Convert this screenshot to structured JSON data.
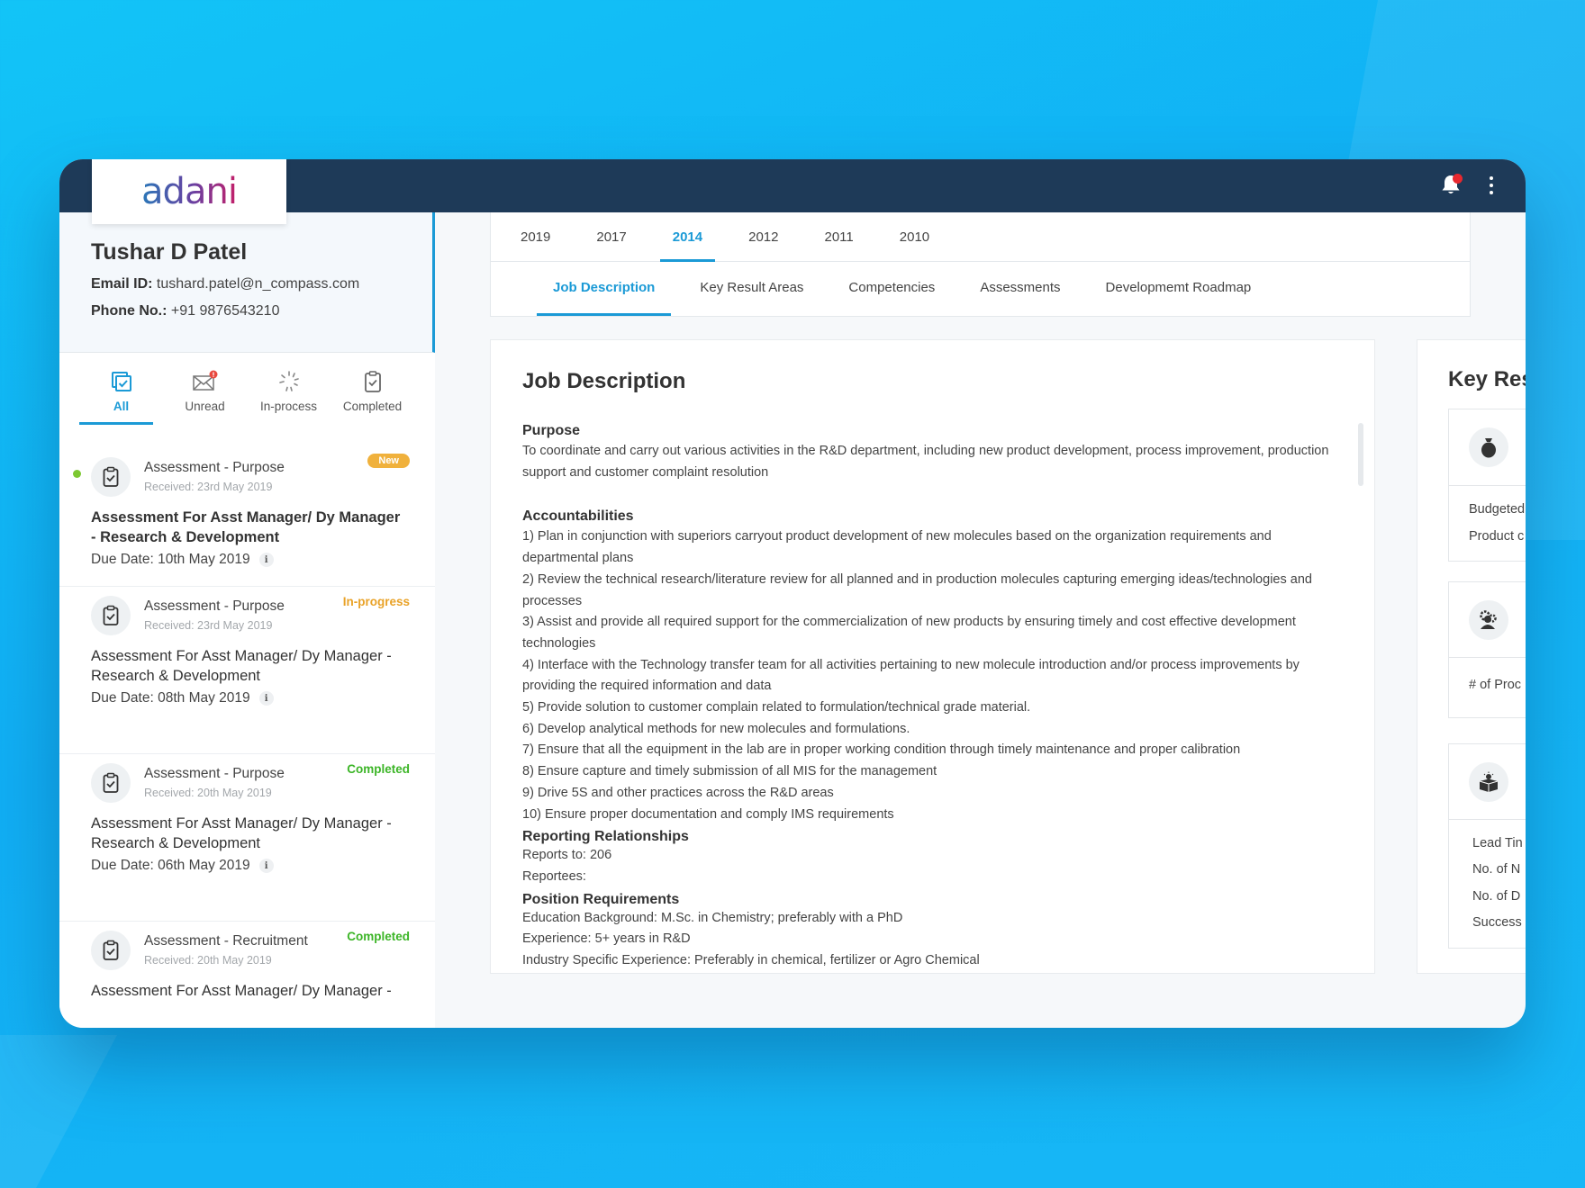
{
  "app": {
    "brand": "adani",
    "colors": {
      "accent": "#1b9ad6",
      "topbar": "#1e3a58",
      "new_badge": "#f0b13c",
      "in_progress": "#e9a227",
      "completed": "#3cb527",
      "unread_dot": "#7dc832",
      "notification": "#e8282f"
    }
  },
  "topbar": {
    "notification_icon": "bell-icon",
    "menu_icon": "more-vertical-icon"
  },
  "profile": {
    "name": "Tushar D Patel",
    "email_label": "Email ID:",
    "email": "tushard.patel@n_compass.com",
    "phone_label": "Phone No.:",
    "phone": "+91 9876543210"
  },
  "filters": [
    {
      "label": "All",
      "icon": "all-check-icon",
      "active": true
    },
    {
      "label": "Unread",
      "icon": "mail-icon",
      "active": false
    },
    {
      "label": "In-process",
      "icon": "spinner-icon",
      "active": false
    },
    {
      "label": "Completed",
      "icon": "clipboard-check-icon",
      "active": false
    }
  ],
  "assessments": [
    {
      "type": "Assessment - Purpose",
      "received": "Received: 23rd May 2019",
      "status": "New",
      "title": "Assessment For Asst Manager/ Dy Manager - Research & Development",
      "due": "Due Date: 10th May 2019",
      "unread": true
    },
    {
      "type": "Assessment - Purpose",
      "received": "Received: 23rd May 2019",
      "status": "In-progress",
      "title": "Assessment For Asst Manager/ Dy Manager - Research & Development",
      "due": "Due Date: 08th May 2019",
      "unread": false
    },
    {
      "type": "Assessment - Purpose",
      "received": "Received: 20th May 2019",
      "status": "Completed",
      "title": "Assessment For Asst Manager/ Dy Manager - Research & Development",
      "due": "Due Date: 06th May 2019",
      "unread": false
    },
    {
      "type": "Assessment - Recruitment",
      "received": "Received: 20th May 2019",
      "status": "Completed",
      "title": "Assessment For Asst Manager/ Dy Manager -",
      "due": "",
      "unread": false
    }
  ],
  "year_tabs": [
    {
      "label": "2019",
      "active": false
    },
    {
      "label": "2017",
      "active": false
    },
    {
      "label": "2014",
      "active": true
    },
    {
      "label": "2012",
      "active": false
    },
    {
      "label": "2011",
      "active": false
    },
    {
      "label": "2010",
      "active": false
    }
  ],
  "section_tabs": [
    {
      "label": "Job Description",
      "active": true
    },
    {
      "label": "Key Result Areas",
      "active": false
    },
    {
      "label": "Competencies",
      "active": false
    },
    {
      "label": "Assessments",
      "active": false
    },
    {
      "label": "Developmemt Roadmap",
      "active": false
    }
  ],
  "job_description": {
    "title": "Job Description",
    "purpose_heading": "Purpose",
    "purpose": "To coordinate and carry out various activities in the R&D department, including new product development, process improvement, production support and customer complaint resolution",
    "accountabilities_heading": "Accountabilities",
    "accountabilities": [
      "1) Plan in conjunction with superiors carryout product development of new molecules based on the organization requirements and departmental plans",
      "2) Review the technical research/literature review for all planned and in production molecules capturing emerging ideas/technologies and processes",
      "3) Assist and provide all required support for the commercialization of new products by ensuring timely and cost effective development technologies",
      "4) Interface with the Technology transfer team for all activities pertaining to new molecule introduction and/or process improvements by providing the required information and data",
      "5) Provide solution to customer complain related to formulation/technical grade material.",
      "6) Develop analytical methods for new molecules and formulations.",
      "7) Ensure that all the equipment in the lab are in proper working condition through timely maintenance and proper calibration",
      "8) Ensure capture and timely submission of all MIS for the management",
      "9) Drive 5S and other practices across the R&D areas",
      "10) Ensure proper documentation and comply IMS requirements"
    ],
    "reporting_heading": "Reporting Relationships",
    "reports_to": "Reports to: 206",
    "reportees": "Reportees:",
    "requirements_heading": "Position Requirements",
    "education": "Education Background: M.Sc. in Chemistry; preferably with a PhD",
    "experience": "Experience: 5+ years in R&D",
    "industry": "Industry Specific Experience: Preferably in chemical, fertilizer or Agro Chemical"
  },
  "key_results": {
    "title": "Key Res",
    "blocks": [
      {
        "icon": "money-bag-icon",
        "lines": [
          "Budgeted",
          "Product c"
        ]
      },
      {
        "icon": "worker-gear-icon",
        "lines": [
          "# of Proc"
        ]
      },
      {
        "icon": "product-box-idea-icon",
        "lines": [
          "Lead Tin",
          "No. of N",
          "No. of D",
          "Success"
        ]
      }
    ]
  }
}
